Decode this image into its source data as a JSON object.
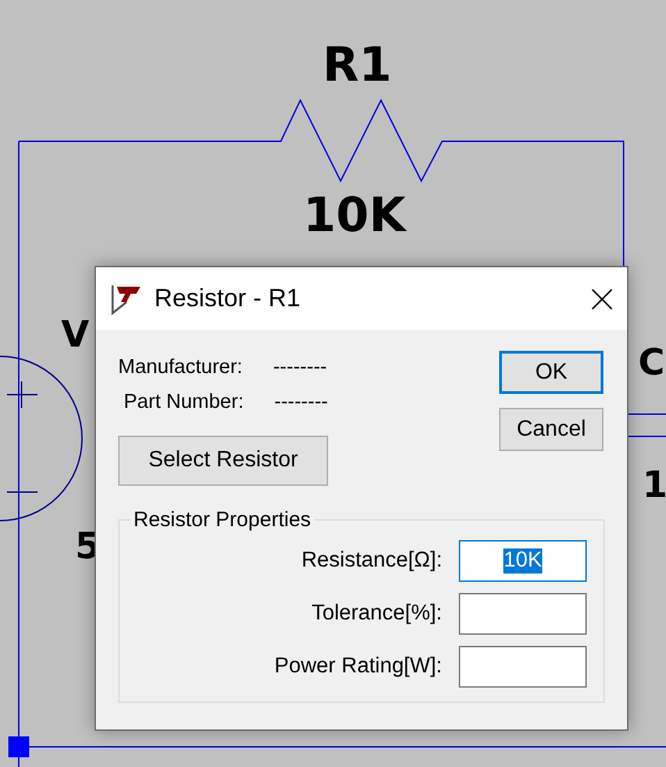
{
  "schematic": {
    "labels": [
      {
        "kind": "name",
        "text": "R1"
      },
      {
        "kind": "value",
        "text": "10K"
      },
      {
        "kind": "left-top",
        "text": "V"
      },
      {
        "kind": "left-bottom",
        "text": "5"
      },
      {
        "kind": "right-top",
        "text": "C"
      },
      {
        "kind": "right-bottom",
        "text": "1"
      }
    ]
  },
  "dialog": {
    "title": "Resistor - R1",
    "info": [
      {
        "label": "Manufacturer:",
        "value": "--------"
      },
      {
        "label": "Part Number:",
        "value": "--------"
      }
    ],
    "select_button": "Select Resistor",
    "buttons": [
      {
        "label": "OK",
        "default": true
      },
      {
        "label": "Cancel",
        "default": false
      }
    ],
    "group": {
      "legend": "Resistor Properties",
      "properties": [
        {
          "label": "Resistance[Ω]:",
          "value": "10K",
          "selected": true
        },
        {
          "label": "Tolerance[%]:",
          "selected": false
        },
        {
          "label": "Power Rating[W]:",
          "selected": false
        }
      ]
    }
  }
}
